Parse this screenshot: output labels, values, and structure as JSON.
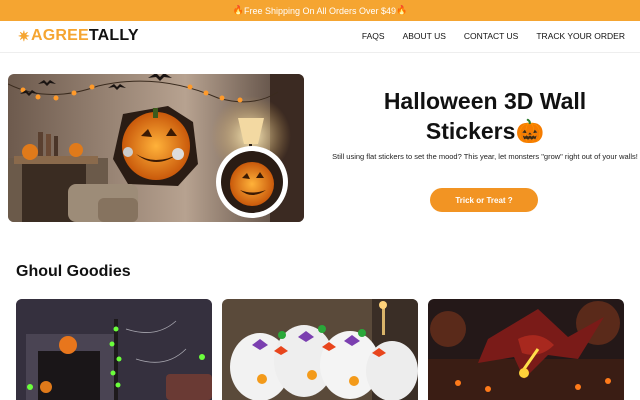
{
  "announcement": {
    "text": "Free Shipping On All Orders Over $49",
    "icon": "fire-icon"
  },
  "header": {
    "logo_part1": "AGREE",
    "logo_part2": "TALLY",
    "logo_icon": "star-icon",
    "nav": [
      "FAQS",
      "ABOUT US",
      "CONTACT US",
      "TRACK YOUR ORDER"
    ]
  },
  "hero": {
    "title_line1": "Halloween 3D Wall",
    "title_line2": "Stickers",
    "title_icon": "pumpkin-icon",
    "description": "Still using flat stickers to set the mood? This year, let monsters \"grow\" right out of your walls!",
    "button": "Trick or Treat ?"
  },
  "section": {
    "title": "Ghoul Goodies"
  },
  "colors": {
    "accent": "#f5a531",
    "button": "#f29423"
  }
}
